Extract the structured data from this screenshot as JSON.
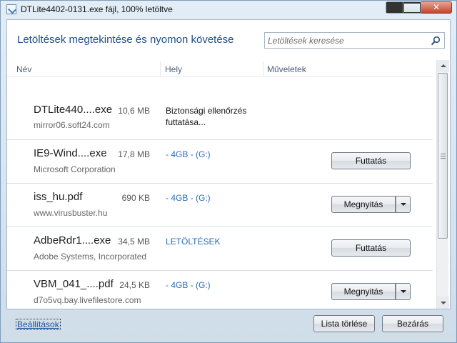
{
  "window": {
    "title": "DTLite4402-0131.exe fájl, 100% letöltve",
    "close_glyph": "✕"
  },
  "header": {
    "title": "Letöltések megtekintése és nyomon követése"
  },
  "search": {
    "placeholder": "Letöltések keresése"
  },
  "columns": {
    "name": "Név",
    "location": "Hely",
    "actions": "Műveletek"
  },
  "downloads": [
    {
      "name": "DTLite440....exe",
      "size": "10,6 MB",
      "source": "mirror06.soft24.com",
      "status": "Biztonsági ellenőrzés futtatása..."
    },
    {
      "name": "IE9-Wind....exe",
      "size": "17,8 MB",
      "source": "Microsoft Corporation",
      "location": "- 4GB - (G:)",
      "action": "Futtatás"
    },
    {
      "name": "iss_hu.pdf",
      "size": "690 KB",
      "source": "www.virusbuster.hu",
      "location": "- 4GB - (G:)",
      "action": "Megnyitás"
    },
    {
      "name": "AdbeRdr1....exe",
      "size": "34,5 MB",
      "source": "Adobe Systems, Incorporated",
      "location": "LETÖLTÉSEK",
      "action": "Futtatás"
    },
    {
      "name": "VBM_041_....pdf",
      "size": "24,5 KB",
      "source": "d7o5vq.bay.livefilestore.com",
      "location": "- 4GB - (G:)",
      "action": "Megnyitás"
    }
  ],
  "footer": {
    "settings_link": "Beállítások",
    "clear_list": "Lista törlése",
    "close": "Bezárás"
  },
  "colors": {
    "header_title": "#1f4e8c",
    "location_link": "#2a6ebb",
    "close_button": "#c5432b"
  }
}
